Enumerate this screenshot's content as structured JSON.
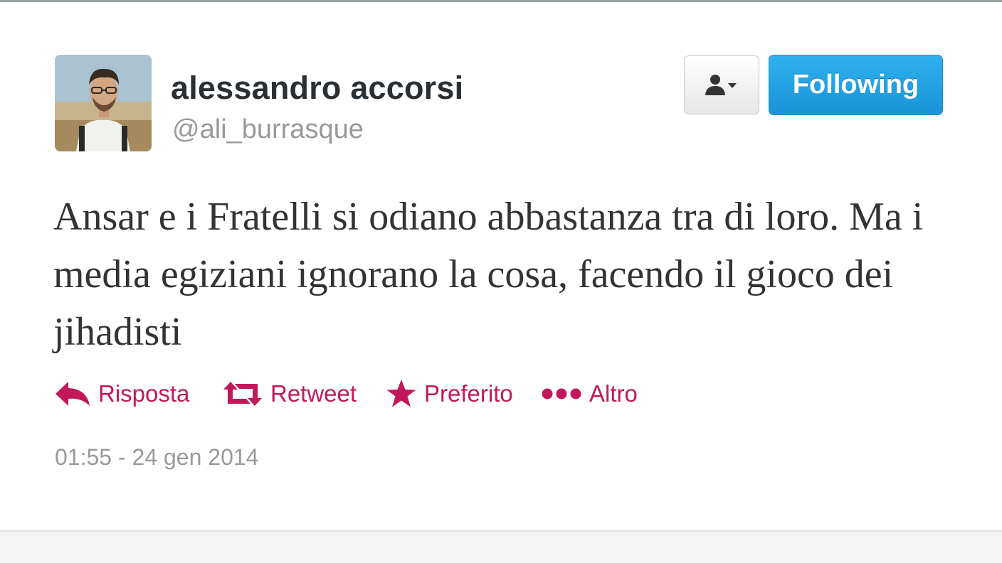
{
  "tweet": {
    "user": {
      "display_name": "alessandro accorsi",
      "screen_name": "@ali_burrasque"
    },
    "follow_button_label": "Following",
    "text": "Ansar e i Fratelli si odiano abbastanza tra di loro. Ma i media egiziani ignorano la cosa, facendo il gioco dei jihadisti",
    "actions": {
      "reply": "Risposta",
      "retweet": "Retweet",
      "favorite": "Preferito",
      "more": "Altro"
    },
    "timestamp": "01:55 - 24 gen 2014"
  },
  "icons": {
    "user_actions": "user-dropdown-icon",
    "reply": "reply-arrow-icon",
    "retweet": "retweet-icon",
    "favorite": "star-icon",
    "more": "ellipsis-icon"
  },
  "colors": {
    "action_pink": "#c2185b",
    "follow_blue": "#1a93d9",
    "name_text": "#292f33",
    "muted_text": "#999999"
  }
}
